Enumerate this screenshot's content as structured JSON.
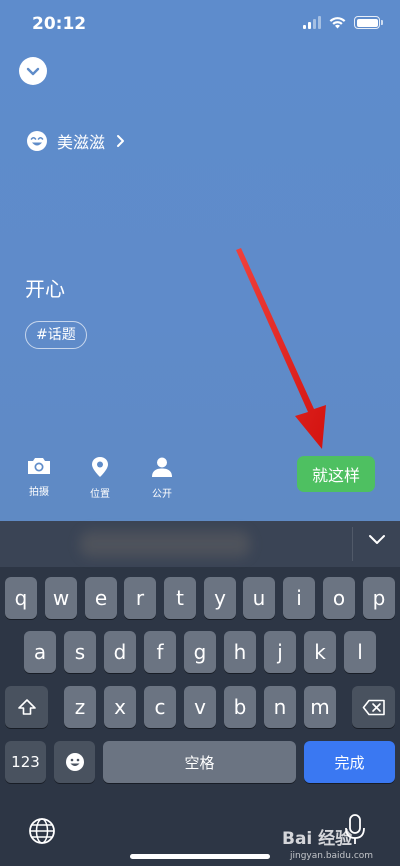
{
  "status_bar": {
    "time": "20:12"
  },
  "composer": {
    "mood_label": "美滋滋",
    "post_text": "开心",
    "topic_tag": "#话题"
  },
  "toolbar": {
    "camera_label": "拍摄",
    "location_label": "位置",
    "public_label": "公开",
    "submit_label": "就这样"
  },
  "keyboard": {
    "row1": [
      "q",
      "w",
      "e",
      "r",
      "t",
      "y",
      "u",
      "i",
      "o",
      "p"
    ],
    "row2": [
      "a",
      "s",
      "d",
      "f",
      "g",
      "h",
      "j",
      "k",
      "l"
    ],
    "row3": [
      "z",
      "x",
      "c",
      "v",
      "b",
      "n",
      "m"
    ],
    "numbers_key": "123",
    "space_key": "空格",
    "done_key": "完成"
  },
  "watermark": {
    "brand": "Bai 经验",
    "url": "jingyan.baidu.com"
  },
  "colors": {
    "background": "#5f8cc9",
    "submit": "#4ec061",
    "done_key": "#3a78f2",
    "arrow": "#e8201c"
  }
}
